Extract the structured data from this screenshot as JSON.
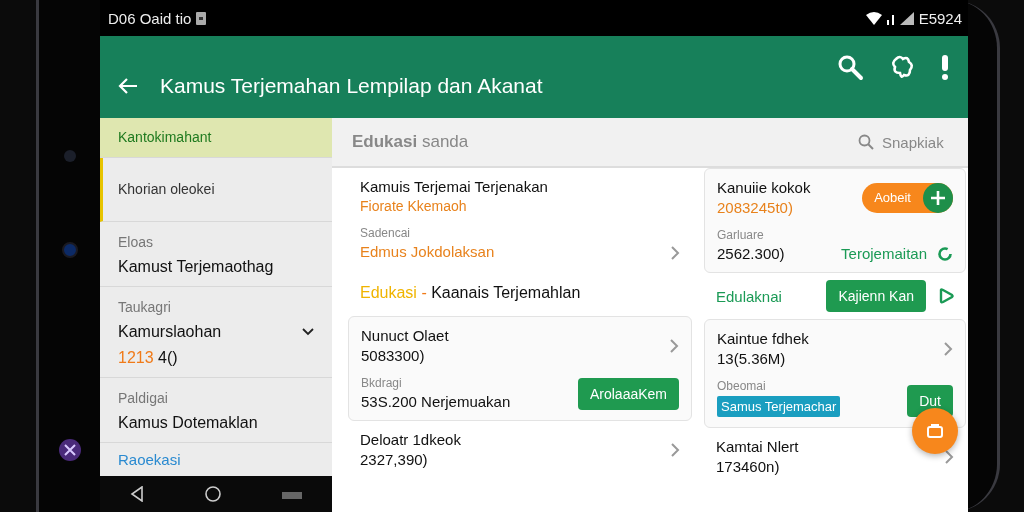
{
  "status_bar": {
    "left": "D06 Oaid tio",
    "right": "E5924"
  },
  "app_bar": {
    "title": "Kamus Terjemahan Lempilap dan Akanat"
  },
  "sidebar": {
    "items": [
      {
        "kind": "nav",
        "label": "Kantokimahant",
        "selected": true
      },
      {
        "kind": "nav",
        "label": "Khorian oleokei",
        "selected": false
      },
      {
        "kind": "group",
        "caption": "Eloas",
        "label": "Kamust Terjemaothag"
      },
      {
        "kind": "group",
        "caption": "Taukagri",
        "label": "Kamurslaohan",
        "value": "**1213** 4()",
        "expanded": true
      },
      {
        "kind": "group",
        "caption": "Paldigai",
        "label": "Kamus Dotemaklan"
      },
      {
        "kind": "link",
        "label": "Raoekasi"
      }
    ]
  },
  "content_header": {
    "title": "**Edukasi** sanda",
    "search": {
      "placeholder": "Snapkiak"
    }
  },
  "left_column": [
    {
      "kind": "plain",
      "title": "Kamuis  Terjemai Terjenakan",
      "subtitle": "Fiorate Kkemaoh",
      "caption": "Sadencai",
      "accent_value": "Edmus Jokdolaksan"
    },
    {
      "kind": "heading",
      "accent": "Edukasi",
      "separator": "-",
      "text": "Kaanais Terjemahlan"
    },
    {
      "kind": "card",
      "title": "Nunuct Olaet",
      "number": "5083300)",
      "caption": "Bkdragi",
      "value": "53S.200 Nerjemuakan",
      "button": "ArolaaaKem"
    },
    {
      "kind": "plain",
      "title": "Deloatr 1dkeok",
      "number": "2327,390)"
    }
  ],
  "right_column": [
    {
      "kind": "card",
      "title": "Kanuiie kokok",
      "accent_number": "2083245t0)",
      "pill": "Aobeit",
      "caption": "Garluare",
      "value": "2562.300)",
      "link": "Terojemaitan"
    },
    {
      "kind": "heading",
      "green": "Edulaknai",
      "button": "Kajienn Kan"
    },
    {
      "kind": "card",
      "title": "Kaintue fdhek",
      "number": "13(5.36M)",
      "caption": "Obeomai",
      "tag": "Samus Terjemachar",
      "button": "Dut"
    },
    {
      "kind": "plain",
      "title": "Kamtai Nlert",
      "number": "173460n)"
    }
  ]
}
